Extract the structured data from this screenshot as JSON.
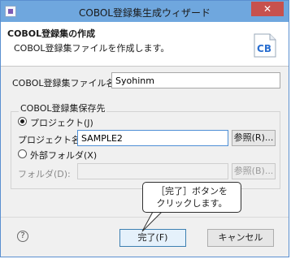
{
  "window": {
    "title": "COBOL登録集生成ウィザード",
    "close_glyph": "✕"
  },
  "banner": {
    "title": "COBOL登録集の作成",
    "description": "COBOL登録集ファイルを作成します。",
    "icon_text": "CB",
    "icon_color": "#2a6fd0"
  },
  "form": {
    "file_name_label": "COBOL登録集ファイル名(C):",
    "file_name_value": "Syohinm",
    "group_title": "COBOL登録集保存先",
    "radio_project_label": "プロジェクト(J)",
    "project_name_label": "プロジェクト名(P):",
    "project_name_value": "SAMPLE2",
    "browse_project_label": "参照(R)...",
    "radio_external_label": "外部フォルダ(X)",
    "folder_label": "フォルダ(D):",
    "folder_value": "",
    "browse_folder_label": "参照(B)..."
  },
  "callout": {
    "line1": "［完了］ボタンを",
    "line2": "クリックします。"
  },
  "footer": {
    "help_glyph": "?",
    "finish_label": "完了(F)",
    "cancel_label": "キャンセル"
  }
}
